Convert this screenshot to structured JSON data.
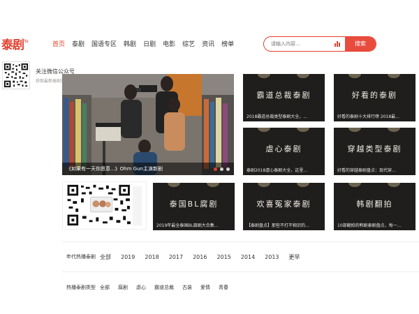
{
  "logo": {
    "text": "泰剧",
    "suffix": "tv"
  },
  "nav": [
    "首页",
    "泰剧",
    "国语专区",
    "韩剧",
    "日剧",
    "电影",
    "综艺",
    "资讯",
    "榜单"
  ],
  "search": {
    "placeholder": "请输入内容...",
    "button": "搜索"
  },
  "qr_popup": {
    "title": "关注微信公众号",
    "subtitle": "获取最新泰剧资讯"
  },
  "banner": {
    "caption": "《如果有一天你愿意...》Ohm Gun主演新剧"
  },
  "cards": [
    {
      "title": "霸道总裁泰剧",
      "sub": "2018霸道总裁类型泰剧大全，..."
    },
    {
      "title": "好看的泰剧",
      "sub": "好看的泰剧十大排行榜 2018最..."
    },
    {
      "title": "虐心泰剧",
      "sub": "泰剧2018虐心泰剧大全，这里..."
    },
    {
      "title": "穿越类型泰剧",
      "sub": "好看的穿越泰剧盘点：现代穿..."
    },
    {
      "title": "泰国BL腐剧",
      "sub": "2019年最全泰国BL腐剧大合集..."
    },
    {
      "title": "欢喜冤家泰剧",
      "sub": "【泰剧盘点】那些不打不相识的..."
    },
    {
      "title": "韩剧翻拍",
      "sub": "10部翻拍的韩剧泰剧盘点，每一..."
    }
  ],
  "filters": {
    "year": {
      "label": "年代热播泰剧",
      "items": [
        "全部",
        "2019",
        "2018",
        "2017",
        "2016",
        "2015",
        "2014",
        "2013",
        "更早"
      ]
    },
    "genre": {
      "label": "热播泰剧类型",
      "items": [
        "全部",
        "腐剧",
        "虐心",
        "霸道总裁",
        "古装",
        "爱情",
        "青春"
      ]
    }
  },
  "colors": {
    "accent": "#e2402f",
    "card_bg": "#1f1e1c",
    "green": "#2ab34a"
  }
}
